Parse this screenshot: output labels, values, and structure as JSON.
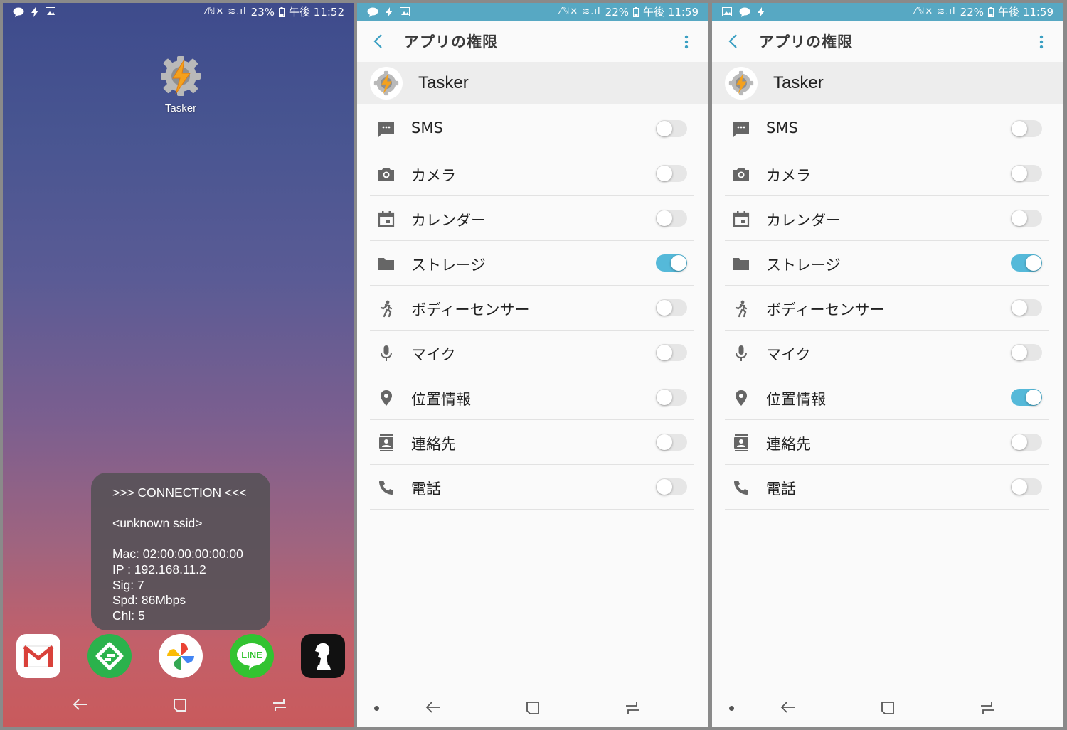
{
  "home": {
    "status": {
      "percent": "23%",
      "time": "午後 11:52"
    },
    "app_label": "Tasker",
    "toast": {
      "header": ">>> CONNECTION <<<",
      "ssid": "<unknown ssid>",
      "mac": "Mac: 02:00:00:00:00:00",
      "ip": "IP : 192.168.11.2",
      "sig": "Sig: 7",
      "spd": "Spd: 86Mbps",
      "chl": "Chl: 5"
    },
    "dock": [
      "gmail",
      "feedly",
      "photos",
      "line",
      "chess"
    ],
    "line_text": "LINE"
  },
  "screen2": {
    "status": {
      "percent": "22%",
      "time": "午後 11:59"
    },
    "title": "アプリの権限",
    "app_name": "Tasker",
    "permissions": [
      {
        "label": "SMS",
        "icon": "sms-icon",
        "on": false
      },
      {
        "label": "カメラ",
        "icon": "camera-icon",
        "on": false
      },
      {
        "label": "カレンダー",
        "icon": "calendar-icon",
        "on": false
      },
      {
        "label": "ストレージ",
        "icon": "folder-icon",
        "on": true
      },
      {
        "label": "ボディーセンサー",
        "icon": "body-sensor-icon",
        "on": false
      },
      {
        "label": "マイク",
        "icon": "mic-icon",
        "on": false
      },
      {
        "label": "位置情報",
        "icon": "location-icon",
        "on": false
      },
      {
        "label": "連絡先",
        "icon": "contacts-icon",
        "on": false
      },
      {
        "label": "電話",
        "icon": "phone-icon",
        "on": false
      }
    ]
  },
  "screen3": {
    "status": {
      "percent": "22%",
      "time": "午後 11:59"
    },
    "title": "アプリの権限",
    "app_name": "Tasker",
    "permissions": [
      {
        "label": "SMS",
        "icon": "sms-icon",
        "on": false
      },
      {
        "label": "カメラ",
        "icon": "camera-icon",
        "on": false
      },
      {
        "label": "カレンダー",
        "icon": "calendar-icon",
        "on": false
      },
      {
        "label": "ストレージ",
        "icon": "folder-icon",
        "on": true
      },
      {
        "label": "ボディーセンサー",
        "icon": "body-sensor-icon",
        "on": false
      },
      {
        "label": "マイク",
        "icon": "mic-icon",
        "on": false
      },
      {
        "label": "位置情報",
        "icon": "location-icon",
        "on": true
      },
      {
        "label": "連絡先",
        "icon": "contacts-icon",
        "on": false
      },
      {
        "label": "電話",
        "icon": "phone-icon",
        "on": false
      }
    ]
  },
  "colors": {
    "accent": "#55b9d9",
    "statusbar": "#57a8c3"
  }
}
